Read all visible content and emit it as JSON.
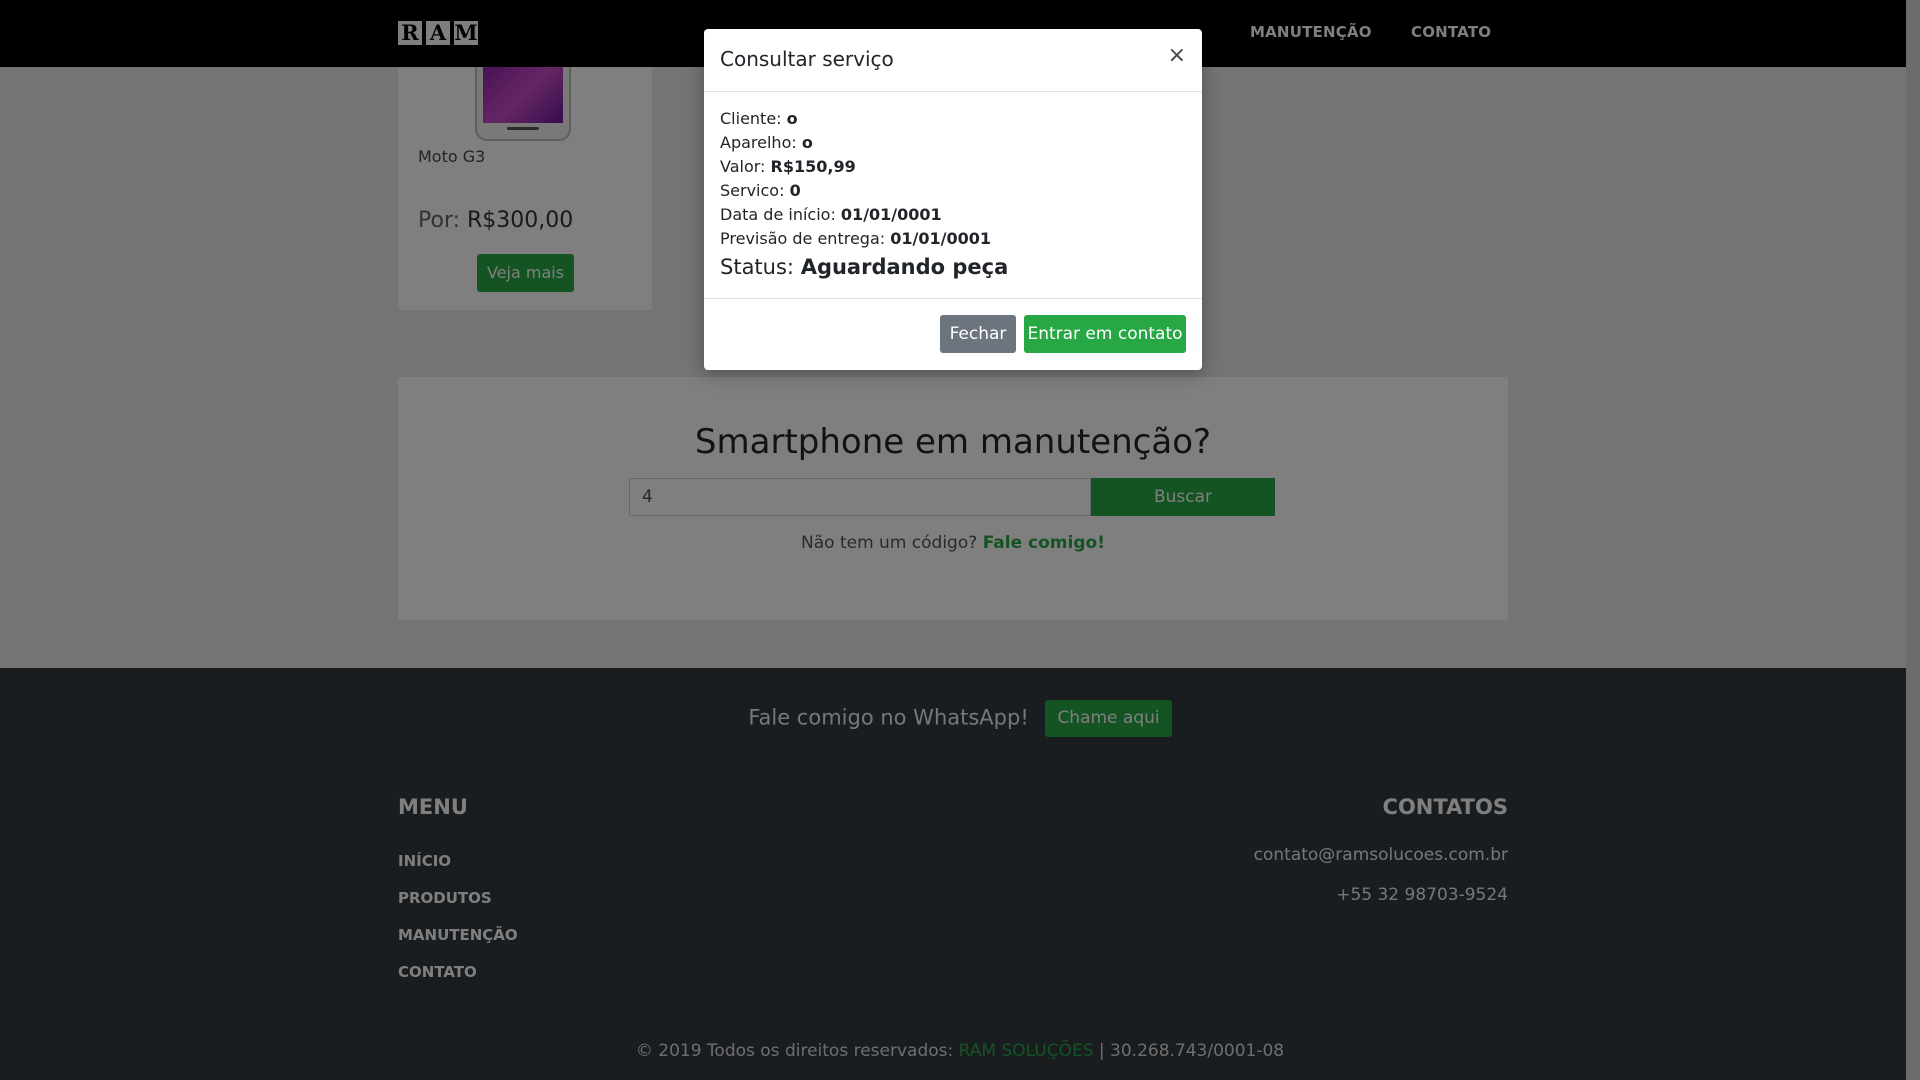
{
  "navbar": {
    "logo_letters": [
      "R",
      "A",
      "M"
    ],
    "links": [
      "MANUTENÇÃO",
      "CONTATO"
    ]
  },
  "product": {
    "name": "Moto G3",
    "price_prefix": "Por:",
    "price": "R$300,00",
    "button": "Veja mais"
  },
  "maintenance": {
    "title": "Smartphone em manutenção?",
    "input_value": "4",
    "button": "Buscar",
    "no_code_text": "Não tem um código?",
    "no_code_link": "Fale comigo!"
  },
  "footer": {
    "whatsapp_text": "Fale comigo no WhatsApp!",
    "whatsapp_button": "Chame aqui",
    "menu_title": "MENU",
    "menu_items": [
      "INÍCIO",
      "PRODUTOS",
      "MANUTENÇÃO",
      "CONTATO"
    ],
    "contacts_title": "CONTATOS",
    "email": "contato@ramsolucoes.com.br",
    "phone": "+55 32 98703-9524",
    "copyright_text": "© 2019 Todos os direitos reservados:",
    "brand": "RAM SOLUÇÕES",
    "separator": "|",
    "cnpj": "30.268.743/0001-08"
  },
  "modal": {
    "title": "Consultar serviço",
    "close": "×",
    "fields": [
      {
        "label": "Cliente:",
        "value": "o"
      },
      {
        "label": "Aparelho:",
        "value": "o"
      },
      {
        "label": "Valor:",
        "value": "R$150,99"
      },
      {
        "label": "Servico:",
        "value": "0"
      },
      {
        "label": "Data de início:",
        "value": "01/01/0001"
      },
      {
        "label": "Previsão de entrega:",
        "value": "01/01/0001"
      }
    ],
    "status_label": "Status:",
    "status_value": "Aguardando peça",
    "close_button": "Fechar",
    "contact_button": "Entrar em contato"
  },
  "colors": {
    "accent": "#28a745",
    "navbar": "#000000",
    "footer": "#343a40",
    "secondary": "#6c757d"
  }
}
